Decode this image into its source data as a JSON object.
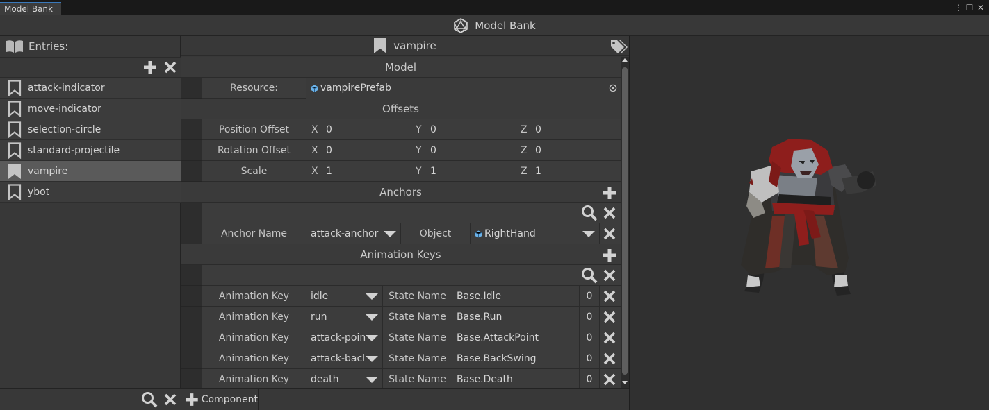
{
  "window": {
    "tab_label": "Model Bank",
    "title": "Model Bank",
    "menu_glyph": "⋮",
    "max_glyph": "☐",
    "close_glyph": "✕"
  },
  "entries": {
    "header": "Entries:",
    "items": [
      {
        "label": "attack-indicator",
        "selected": false
      },
      {
        "label": "move-indicator",
        "selected": false
      },
      {
        "label": "selection-circle",
        "selected": false
      },
      {
        "label": "standard-projectile",
        "selected": false
      },
      {
        "label": "vampire",
        "selected": true
      },
      {
        "label": "ybot",
        "selected": false
      }
    ]
  },
  "entry": {
    "name": "vampire"
  },
  "model": {
    "section": "Model",
    "resource_label": "Resource:",
    "resource_value": "vampirePrefab"
  },
  "offsets": {
    "section": "Offsets",
    "rows": [
      {
        "label": "Position  Offset",
        "x": "0",
        "y": "0",
        "z": "0"
      },
      {
        "label": "Rotation  Offset",
        "x": "0",
        "y": "0",
        "z": "0"
      },
      {
        "label": "Scale",
        "x": "1",
        "y": "1",
        "z": "1"
      }
    ],
    "axis_x": "X",
    "axis_y": "Y",
    "axis_z": "Z"
  },
  "anchors": {
    "section": "Anchors",
    "name_label": "Anchor Name",
    "name_value": "attack-anchor",
    "object_label": "Object",
    "object_value": "RightHand"
  },
  "animation_keys": {
    "section": "Animation Keys",
    "key_label": "Animation Key",
    "state_label": "State Name",
    "rows": [
      {
        "key": "idle",
        "state": "Base.Idle",
        "layer": "0"
      },
      {
        "key": "run",
        "state": "Base.Run",
        "layer": "0"
      },
      {
        "key": "attack-poin",
        "state": "Base.AttackPoint",
        "layer": "0"
      },
      {
        "key": "attack-bacl",
        "state": "Base.BackSwing",
        "layer": "0"
      },
      {
        "key": "death",
        "state": "Base.Death",
        "layer": "0"
      }
    ]
  },
  "footer": {
    "add_component_label": "Component"
  },
  "colors": {
    "accent": "#3a79bb",
    "prefab_icon": "#6bb2e8",
    "selected_row": "#5a5a5a"
  }
}
